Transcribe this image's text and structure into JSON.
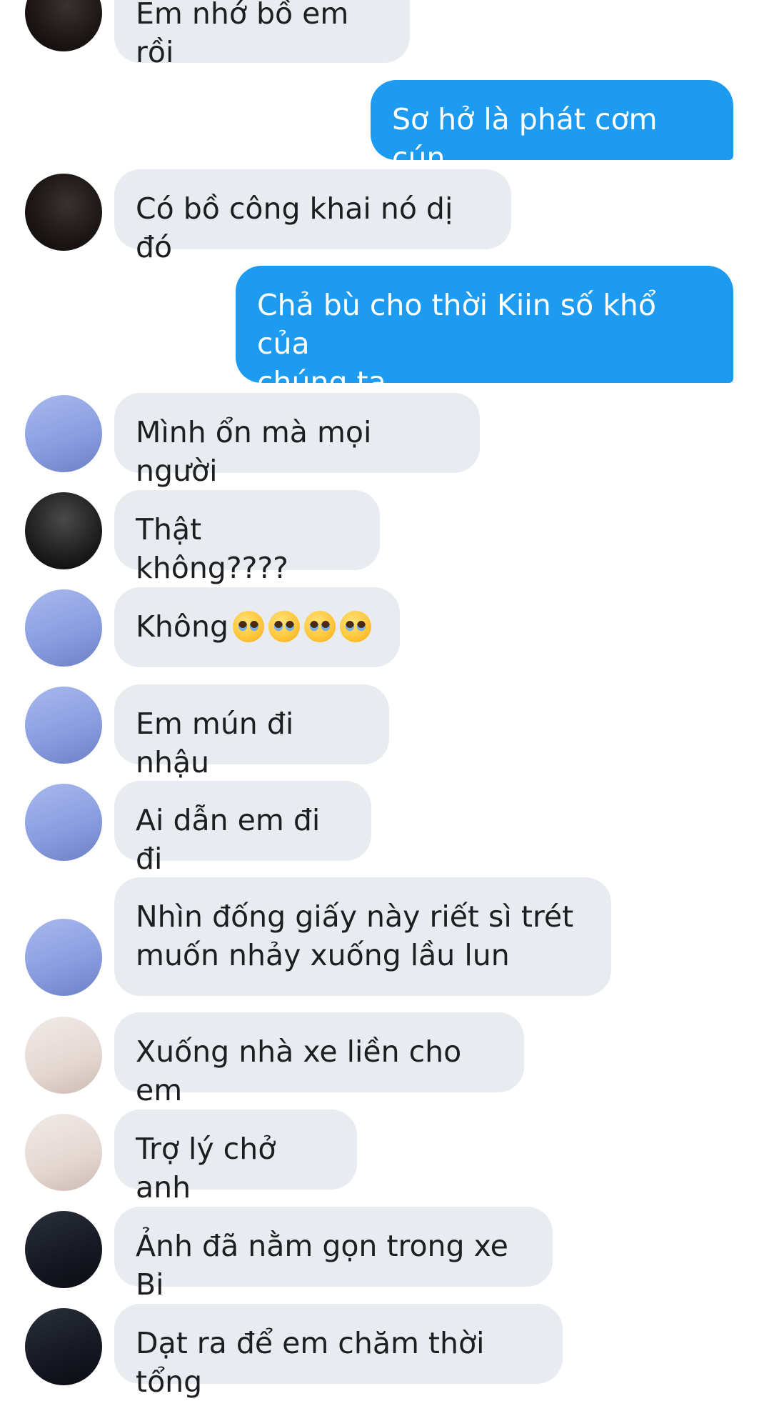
{
  "messages": [
    {
      "side": "in",
      "avatar": "dark",
      "text": "Em nhớ bồ em rồi"
    },
    {
      "side": "out",
      "text": "Sơ hở là phát cơm cún"
    },
    {
      "side": "in",
      "avatar": "dark",
      "text": "Có bồ công khai nó dị đó"
    },
    {
      "side": "out",
      "text": "Chả bù cho thời Kiin số khổ của\nchúng ta"
    },
    {
      "side": "in",
      "avatar": "suit",
      "text": "Mình ổn mà mọi người"
    },
    {
      "side": "in",
      "avatar": "portrait",
      "text": "Thật không????"
    },
    {
      "side": "in",
      "avatar": "suit",
      "text": "Không",
      "emoji_count": 4,
      "emoji_name": "pleading-face-emoji"
    },
    {
      "side": "in",
      "avatar": "suit",
      "text": "Em mún đi nhậu"
    },
    {
      "side": "in",
      "avatar": "suit",
      "text": "Ai dẫn em đi đi"
    },
    {
      "side": "in",
      "avatar": "suit",
      "text": "Nhìn đống giấy này riết sì trét\nmuốn nhảy xuống lầu lun"
    },
    {
      "side": "in",
      "avatar": "light",
      "text": "Xuống nhà xe liền cho em"
    },
    {
      "side": "in",
      "avatar": "light",
      "text": "Trợ lý chở anh"
    },
    {
      "side": "in",
      "avatar": "black",
      "text": "Ảnh đã nằm gọn trong xe Bi"
    },
    {
      "side": "in",
      "avatar": "black",
      "text": "Dạt ra để em chăm thời tổng"
    }
  ],
  "colors": {
    "incoming_bubble": "#e8ecf1",
    "outgoing_bubble": "#1d9bf0",
    "incoming_text": "#1c1e21",
    "outgoing_text": "#ffffff",
    "background": "#ffffff"
  }
}
